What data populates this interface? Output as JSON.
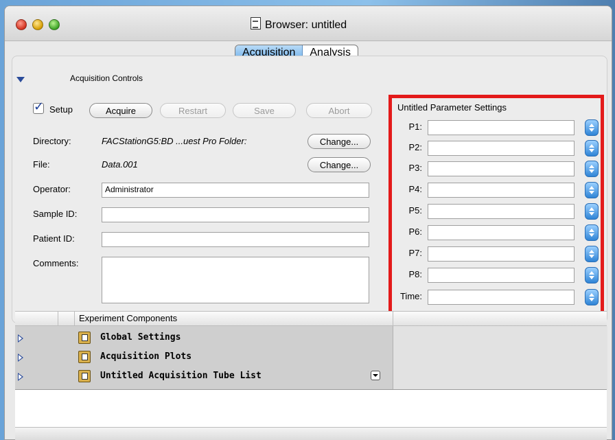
{
  "window": {
    "title": "Browser: untitled",
    "tabs": [
      {
        "label": "Acquisition",
        "active": true
      },
      {
        "label": "Analysis",
        "active": false
      }
    ]
  },
  "acquisition_controls": {
    "section_label": "Acquisition Controls",
    "setup_label": "Setup",
    "setup_checked": true,
    "buttons": {
      "acquire": "Acquire",
      "restart": "Restart",
      "save": "Save",
      "abort": "Abort"
    },
    "directory_label": "Directory:",
    "directory_value": "FACStationG5:BD ...uest Pro Folder:",
    "file_label": "File:",
    "file_value": "Data.001",
    "change_button": "Change...",
    "operator_label": "Operator:",
    "operator_value": "Administrator",
    "sample_label": "Sample ID:",
    "sample_value": "",
    "patient_label": "Patient ID:",
    "patient_value": "",
    "comments_label": "Comments:",
    "comments_value": ""
  },
  "parameter_settings": {
    "title": "Untitled Parameter Settings",
    "rows": [
      "P1:",
      "P2:",
      "P3:",
      "P4:",
      "P5:",
      "P6:",
      "P7:",
      "P8:",
      "Time:"
    ]
  },
  "experiment": {
    "column_header": "Experiment Components",
    "rows": [
      {
        "label": "Global Settings",
        "icon": "settings-folder-icon"
      },
      {
        "label": "Acquisition Plots",
        "icon": "plots-folder-icon"
      },
      {
        "label": "Untitled Acquisition Tube List",
        "icon": "tube-list-folder-icon"
      }
    ]
  },
  "colors": {
    "highlight_box": "#e31a1a",
    "accent_blue": "#2f84d6"
  }
}
